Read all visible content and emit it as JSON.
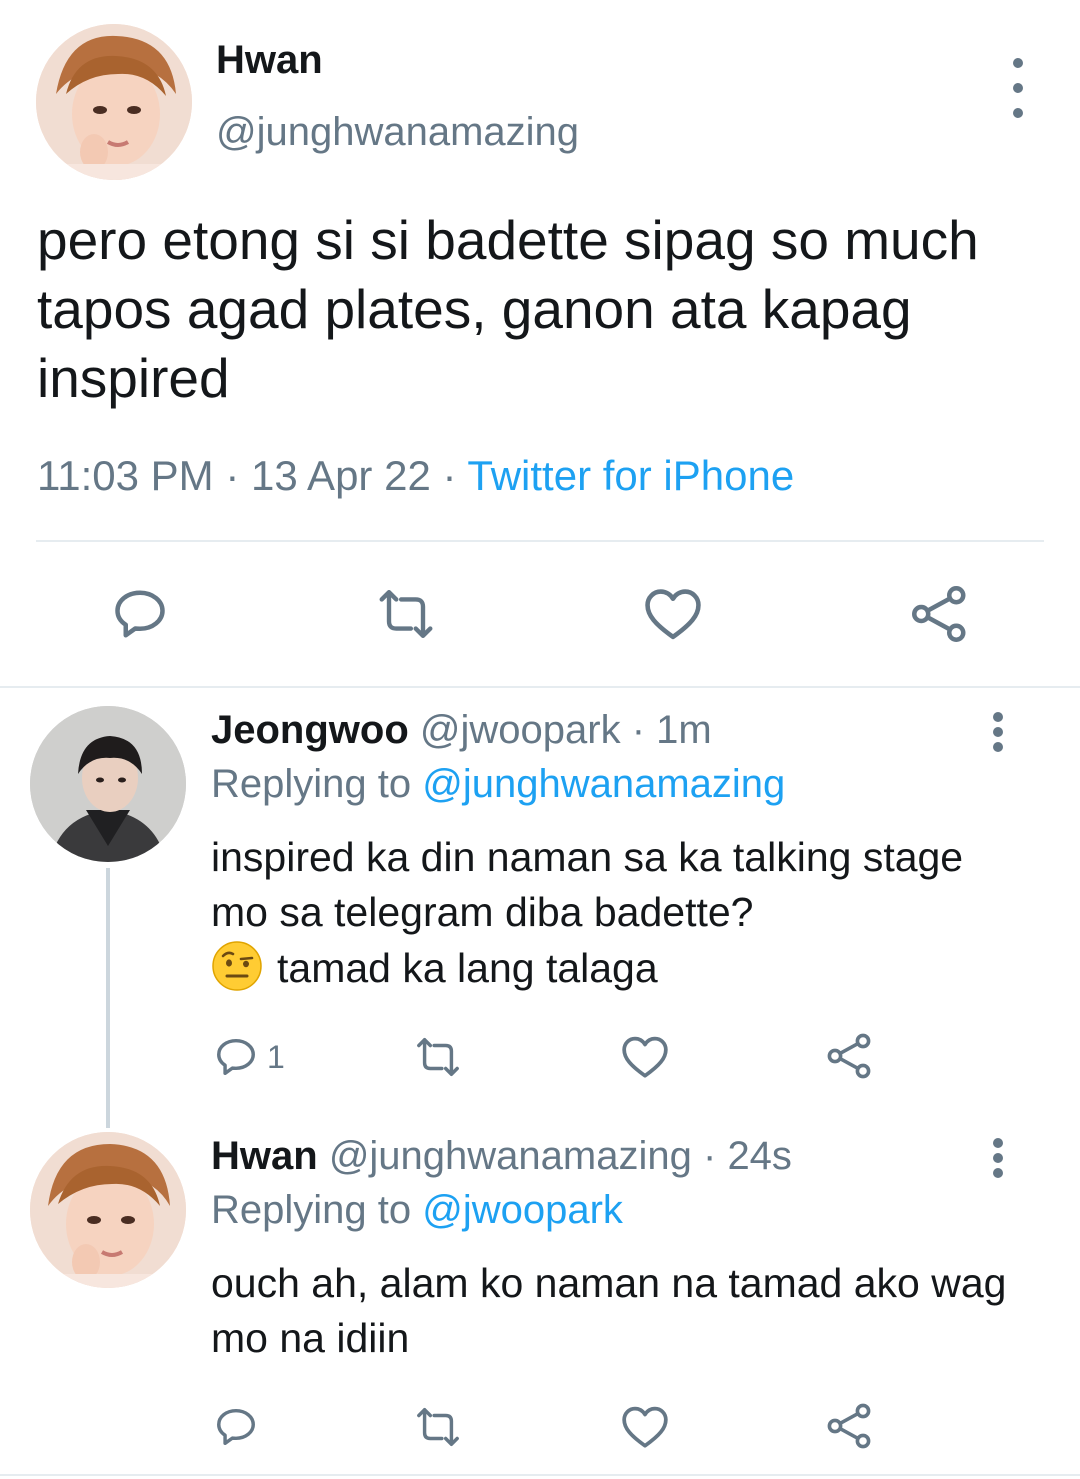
{
  "main_tweet": {
    "display_name": "Hwan",
    "handle": "@junghwanamazing",
    "text": "pero etong si si badette sipag so much tapos agad plates, ganon ata kapag inspired",
    "time": "11:03 PM",
    "date": "13 Apr 22",
    "source": "Twitter for iPhone",
    "sep": " · "
  },
  "replies": [
    {
      "display_name": "Jeongwoo",
      "handle": "@jwoopark",
      "age": "1m",
      "replying_label": "Replying to",
      "replying_to": "@junghwanamazing",
      "text_line1": "inspired ka din naman sa ka talking stage mo sa telegram diba badette?",
      "text_line2": "tamad ka lang talaga",
      "emoji": "raised-eyebrow-emoji",
      "reply_count": "1"
    },
    {
      "display_name": "Hwan",
      "handle": "@junghwanamazing",
      "age": "24s",
      "replying_label": "Replying to",
      "replying_to": "@jwoopark",
      "text": "ouch ah, alam ko naman na tamad ako wag mo na idiin"
    }
  ],
  "colors": {
    "text": "#14171a",
    "secondary": "#657786",
    "accent": "#1da1f2",
    "divider": "#e6ecf0",
    "thread_line": "#ccd6dd"
  }
}
